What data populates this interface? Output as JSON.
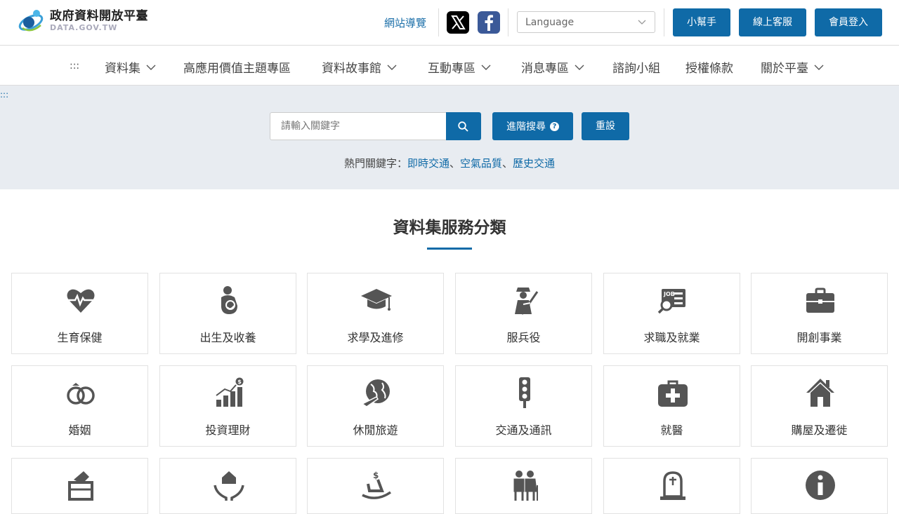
{
  "header": {
    "logo_title": "政府資料開放平臺",
    "logo_sub": "DATA.GOV.TW",
    "sitemap": "網站導覽",
    "language_placeholder": "Language",
    "buttons": [
      "小幫手",
      "線上客服",
      "會員登入"
    ]
  },
  "nav": {
    "dots": ":::",
    "items": [
      "資料集",
      "高應用價值主題專區",
      "資料故事館",
      "互動專區",
      "消息專區",
      "諮詢小組",
      "授權條款",
      "關於平臺"
    ]
  },
  "search": {
    "skip": ":::",
    "placeholder": "請輸入關鍵字",
    "advanced": "進階搜尋",
    "reset": "重設",
    "hot_label": "熱門關鍵字：",
    "hot_keywords": [
      "即時交通",
      "空氣品質",
      "歷史交通"
    ],
    "separator": "、"
  },
  "section": {
    "title": "資料集服務分類"
  },
  "categories": [
    {
      "label": "生育保健",
      "icon": "heart-pulse-icon"
    },
    {
      "label": "出生及收養",
      "icon": "baby-icon"
    },
    {
      "label": "求學及進修",
      "icon": "graduation-cap-icon"
    },
    {
      "label": "服兵役",
      "icon": "soldier-icon"
    },
    {
      "label": "求職及就業",
      "icon": "job-search-icon"
    },
    {
      "label": "開創事業",
      "icon": "briefcase-icon"
    },
    {
      "label": "婚姻",
      "icon": "rings-icon"
    },
    {
      "label": "投資理財",
      "icon": "growth-chart-icon"
    },
    {
      "label": "休閒旅遊",
      "icon": "globe-plane-icon"
    },
    {
      "label": "交通及通訊",
      "icon": "traffic-light-icon"
    },
    {
      "label": "就醫",
      "icon": "medical-kit-icon"
    },
    {
      "label": "購屋及遷徙",
      "icon": "house-icon"
    },
    {
      "label": "",
      "icon": "ballot-box-icon"
    },
    {
      "label": "",
      "icon": "care-hands-icon"
    },
    {
      "label": "",
      "icon": "rocking-chair-icon"
    },
    {
      "label": "",
      "icon": "elderly-icon"
    },
    {
      "label": "",
      "icon": "gravestone-icon"
    },
    {
      "label": "",
      "icon": "info-icon"
    }
  ]
}
